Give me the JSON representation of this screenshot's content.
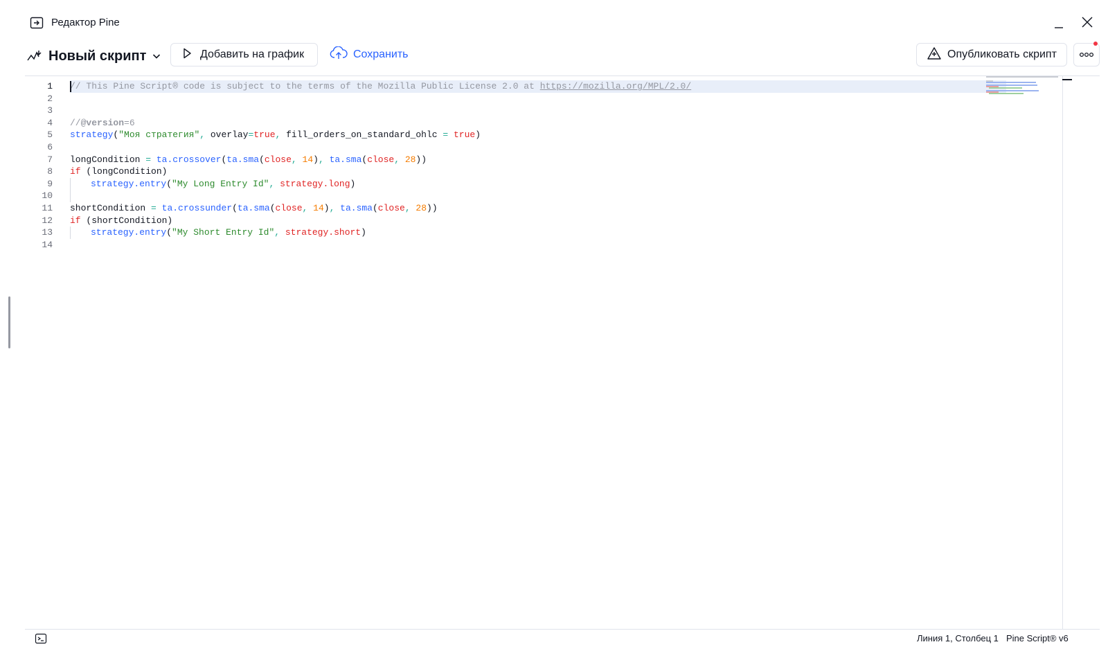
{
  "window": {
    "title": "Редактор Pine",
    "minimize_label": "_",
    "close_label": "close"
  },
  "toolbar": {
    "script_name": "Новый скрипт",
    "add_to_chart": "Добавить на график",
    "save": "Сохранить",
    "publish": "Опубликовать скрипт"
  },
  "editor": {
    "active_line": 1,
    "line_numbers": [
      "1",
      "2",
      "3",
      "4",
      "5",
      "6",
      "7",
      "8",
      "9",
      "10",
      "11",
      "12",
      "13",
      "14"
    ],
    "lines": [
      [
        {
          "c": "t-comment",
          "t": "// This Pine Script® code is subject to the terms of the Mozilla Public License 2.0 at "
        },
        {
          "c": "t-link",
          "t": "https://mozilla.org/MPL/2.0/"
        }
      ],
      [],
      [],
      [
        {
          "c": "t-comment",
          "t": "//"
        },
        {
          "c": "t-ver",
          "t": "@version"
        },
        {
          "c": "t-comment",
          "t": "=6"
        }
      ],
      [
        {
          "c": "t-func",
          "t": "strategy"
        },
        {
          "c": "",
          "t": "("
        },
        {
          "c": "t-str",
          "t": "\"Моя стратегия\""
        },
        {
          "c": "t-op",
          "t": ", "
        },
        {
          "c": "",
          "t": "overlay"
        },
        {
          "c": "t-op",
          "t": "="
        },
        {
          "c": "t-kw",
          "t": "true"
        },
        {
          "c": "t-op",
          "t": ", "
        },
        {
          "c": "",
          "t": "fill_orders_on_standard_ohlc "
        },
        {
          "c": "t-op",
          "t": "="
        },
        {
          "c": "",
          "t": " "
        },
        {
          "c": "t-kw",
          "t": "true"
        },
        {
          "c": "",
          "t": ")"
        }
      ],
      [],
      [
        {
          "c": "",
          "t": "longCondition "
        },
        {
          "c": "t-op",
          "t": "="
        },
        {
          "c": "",
          "t": " "
        },
        {
          "c": "t-func",
          "t": "ta.crossover"
        },
        {
          "c": "",
          "t": "("
        },
        {
          "c": "t-func",
          "t": "ta.sma"
        },
        {
          "c": "",
          "t": "("
        },
        {
          "c": "t-kw",
          "t": "close"
        },
        {
          "c": "t-op",
          "t": ", "
        },
        {
          "c": "t-num",
          "t": "14"
        },
        {
          "c": "",
          "t": ")"
        },
        {
          "c": "t-op",
          "t": ", "
        },
        {
          "c": "t-func",
          "t": "ta.sma"
        },
        {
          "c": "",
          "t": "("
        },
        {
          "c": "t-kw",
          "t": "close"
        },
        {
          "c": "t-op",
          "t": ", "
        },
        {
          "c": "t-num",
          "t": "28"
        },
        {
          "c": "",
          "t": "))"
        }
      ],
      [
        {
          "c": "t-kw",
          "t": "if"
        },
        {
          "c": "",
          "t": " (longCondition)"
        }
      ],
      [
        {
          "c": "indent",
          "t": ""
        },
        {
          "c": "t-func",
          "t": "strategy.entry"
        },
        {
          "c": "",
          "t": "("
        },
        {
          "c": "t-str",
          "t": "\"My Long Entry Id\""
        },
        {
          "c": "t-op",
          "t": ", "
        },
        {
          "c": "t-kw",
          "t": "strategy.long"
        },
        {
          "c": "",
          "t": ")"
        }
      ],
      [
        {
          "c": "indent",
          "t": ""
        }
      ],
      [
        {
          "c": "",
          "t": "shortCondition "
        },
        {
          "c": "t-op",
          "t": "="
        },
        {
          "c": "",
          "t": " "
        },
        {
          "c": "t-func",
          "t": "ta.crossunder"
        },
        {
          "c": "",
          "t": "("
        },
        {
          "c": "t-func",
          "t": "ta.sma"
        },
        {
          "c": "",
          "t": "("
        },
        {
          "c": "t-kw",
          "t": "close"
        },
        {
          "c": "t-op",
          "t": ", "
        },
        {
          "c": "t-num",
          "t": "14"
        },
        {
          "c": "",
          "t": ")"
        },
        {
          "c": "t-op",
          "t": ", "
        },
        {
          "c": "t-func",
          "t": "ta.sma"
        },
        {
          "c": "",
          "t": "("
        },
        {
          "c": "t-kw",
          "t": "close"
        },
        {
          "c": "t-op",
          "t": ", "
        },
        {
          "c": "t-num",
          "t": "28"
        },
        {
          "c": "",
          "t": "))"
        }
      ],
      [
        {
          "c": "t-kw",
          "t": "if"
        },
        {
          "c": "",
          "t": " (shortCondition)"
        }
      ],
      [
        {
          "c": "indent",
          "t": ""
        },
        {
          "c": "t-func",
          "t": "strategy.entry"
        },
        {
          "c": "",
          "t": "("
        },
        {
          "c": "t-str",
          "t": "\"My Short Entry Id\""
        },
        {
          "c": "t-op",
          "t": ", "
        },
        {
          "c": "t-kw",
          "t": "strategy.short"
        },
        {
          "c": "",
          "t": ")"
        }
      ],
      []
    ]
  },
  "status": {
    "cursor_position": "Линия 1, Столбец 1",
    "language_version": "Pine Script® v6"
  },
  "colors": {
    "accent": "#2962ff",
    "string": "#2e8b2e",
    "keyword": "#e02424",
    "number": "#f57c00",
    "operator": "#22ab94",
    "comment": "#9598a1",
    "notification": "#f23645"
  },
  "icons": {
    "title": "pine-editor-icon",
    "script": "script-type-icon",
    "dropdown": "chevron-down-icon",
    "add": "play-icon",
    "save": "cloud-upload-icon",
    "publish": "publish-icon",
    "more": "more-icon",
    "console": "console-icon"
  }
}
